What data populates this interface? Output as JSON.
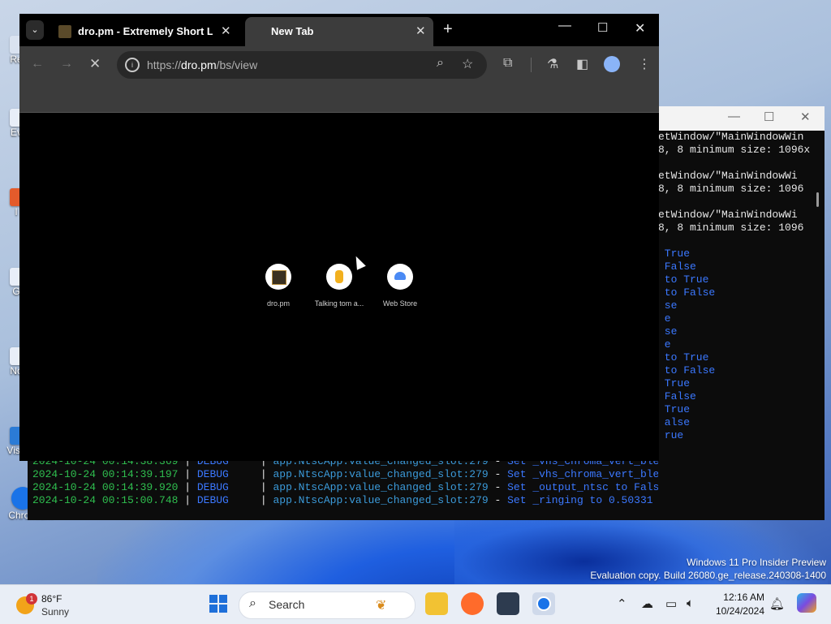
{
  "browser": {
    "tabs": [
      {
        "title": "dro.pm - Extremely Short Links",
        "active": false
      },
      {
        "title": "New Tab",
        "active": true
      }
    ],
    "url": {
      "prefix": "https://",
      "host": "dro.pm",
      "path": "/bs/view"
    },
    "shortcuts": [
      {
        "label": "dro.pm",
        "icon": "dro-pm-favicon"
      },
      {
        "label": "Talking tom a...",
        "icon": "talking-tom-favicon"
      },
      {
        "label": "Web Store",
        "icon": "web-store-icon"
      }
    ]
  },
  "terminal": {
    "right_fragments": [
      "etWindow/\"MainWindowWin",
      "8, 8 minimum size: 1096x",
      "",
      "etWindow/\"MainWindowWi",
      "8, 8 minimum size: 1096",
      "",
      "etWindow/\"MainWindowWi",
      "8, 8 minimum size: 1096",
      "",
      " True",
      " False",
      " to True",
      " to False",
      " se",
      " e",
      " se",
      " e",
      " to True",
      " to False",
      " True",
      " False",
      " True",
      " alse",
      " rue"
    ],
    "log_lines": [
      {
        "ts": "2024-10-24 00:14:38.369",
        "level": "DEBUG",
        "module": "app.NtscApp:value_changed_slot:279",
        "msg": "Set _vhs_chroma_vert_blend to False"
      },
      {
        "ts": "2024-10-24 00:14:39.197",
        "level": "DEBUG",
        "module": "app.NtscApp:value_changed_slot:279",
        "msg": "Set _vhs_chroma_vert_blend to True"
      },
      {
        "ts": "2024-10-24 00:14:39.920",
        "level": "DEBUG",
        "module": "app.NtscApp:value_changed_slot:279",
        "msg": "Set _output_ntsc to False"
      },
      {
        "ts": "2024-10-24 00:15:00.748",
        "level": "DEBUG",
        "module": "app.NtscApp:value_changed_slot:279",
        "msg": "Set _ringing to 0.50331"
      }
    ]
  },
  "desktop": {
    "icons": [
      {
        "label": "Re"
      },
      {
        "label": "Ev"
      },
      {
        "label": "I"
      },
      {
        "label": "G"
      },
      {
        "label": "No"
      },
      {
        "label": "Visu"
      },
      {
        "label": "Chromium"
      }
    ],
    "watermark_line1": "Windows 11 Pro Insider Preview",
    "watermark_line2": "Evaluation copy. Build 26080.ge_release.240308-1400"
  },
  "taskbar": {
    "weather_badge": "1",
    "weather_temp": "86°F",
    "weather_cond": "Sunny",
    "search_label": "Search",
    "time": "12:16 AM",
    "date": "10/24/2024"
  }
}
